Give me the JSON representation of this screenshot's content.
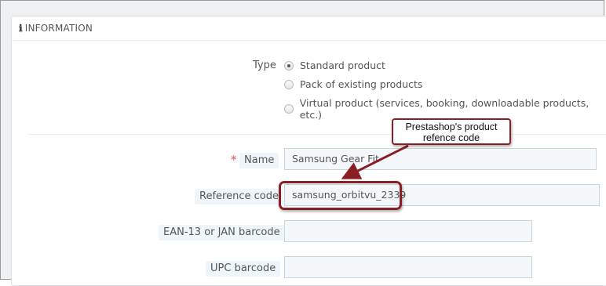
{
  "panel": {
    "heading_icon": "info-icon",
    "heading": "INFORMATION"
  },
  "type": {
    "label": "Type",
    "options": [
      {
        "label": "Standard product",
        "checked": true
      },
      {
        "label": "Pack of existing products",
        "checked": false
      },
      {
        "label": "Virtual product (services, booking, downloadable products, etc.)",
        "checked": false
      }
    ]
  },
  "fields": {
    "name": {
      "required_mark": "*",
      "label": "Name",
      "value": "Samsung Gear Fit"
    },
    "reference": {
      "label": "Reference code",
      "value": "samsung_orbitvu_2339"
    },
    "ean": {
      "label": "EAN-13 or JAN barcode",
      "value": ""
    },
    "upc": {
      "label": "UPC barcode",
      "value": ""
    }
  },
  "annotation": {
    "text": "Prestashop's product refence code",
    "color": "#8b1e24"
  }
}
